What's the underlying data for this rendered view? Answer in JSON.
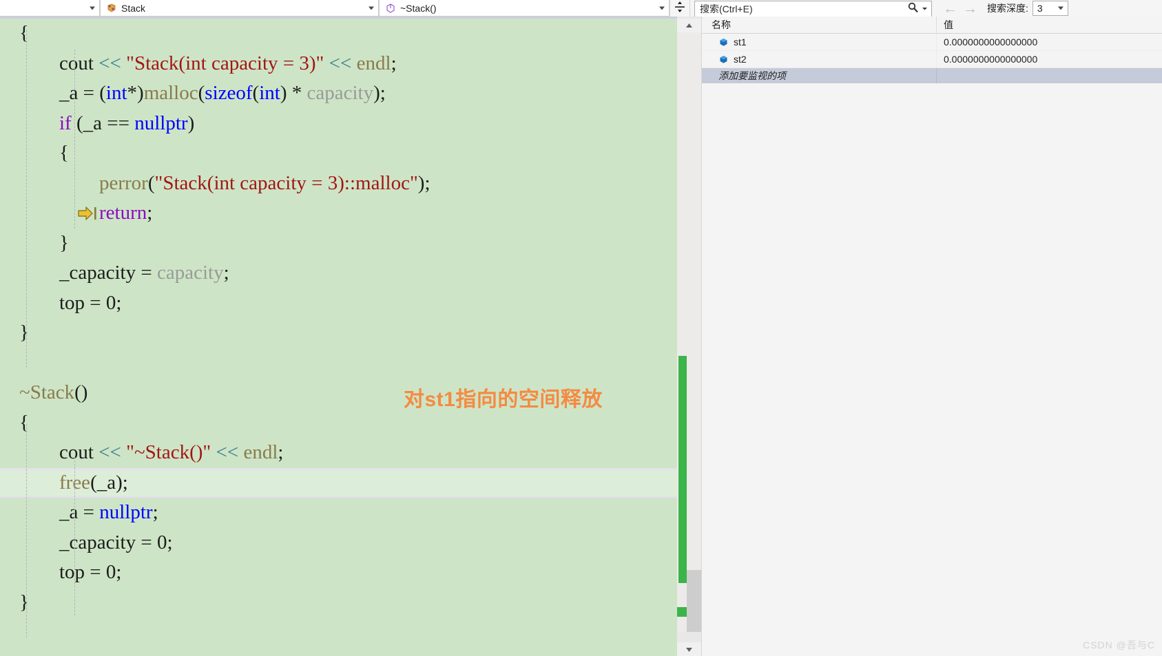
{
  "toolbar": {
    "project_combo": {
      "label": "",
      "icon": "chevron-down-icon"
    },
    "class_combo": {
      "label": "Stack",
      "icon": "class-icon"
    },
    "member_combo": {
      "label": "~Stack()",
      "icon": "method-icon"
    },
    "splitter_icon": "split-view-icon",
    "search": {
      "placeholder": "搜索(Ctrl+E)",
      "value": "",
      "icon": "search-icon"
    },
    "nav_back_icon": "arrow-left-icon",
    "nav_forward_icon": "arrow-right-icon",
    "depth_label": "搜索深度:",
    "depth_value": "3"
  },
  "editor": {
    "annotation": "对st1指向的空间释放",
    "exec_marker_icon": "current-statement-arrow-icon",
    "lines": [
      {
        "indent": 0,
        "tokens": [
          {
            "t": "{",
            "c": "t-plain"
          }
        ]
      },
      {
        "indent": 1,
        "tokens": [
          {
            "t": "cout ",
            "c": "t-plain"
          },
          {
            "t": "<<",
            "c": "t-op"
          },
          {
            "t": " ",
            "c": "t-plain"
          },
          {
            "t": "\"Stack(int capacity = 3)\"",
            "c": "t-str"
          },
          {
            "t": " ",
            "c": "t-plain"
          },
          {
            "t": "<<",
            "c": "t-op"
          },
          {
            "t": " ",
            "c": "t-plain"
          },
          {
            "t": "endl",
            "c": "t-fn"
          },
          {
            "t": ";",
            "c": "t-plain"
          }
        ]
      },
      {
        "indent": 1,
        "tokens": [
          {
            "t": "_a = (",
            "c": "t-plain"
          },
          {
            "t": "int",
            "c": "t-kw"
          },
          {
            "t": "*)",
            "c": "t-plain"
          },
          {
            "t": "malloc",
            "c": "t-fn"
          },
          {
            "t": "(",
            "c": "t-plain"
          },
          {
            "t": "sizeof",
            "c": "t-kw"
          },
          {
            "t": "(",
            "c": "t-plain"
          },
          {
            "t": "int",
            "c": "t-kw"
          },
          {
            "t": ") * ",
            "c": "t-plain"
          },
          {
            "t": "capacity",
            "c": "t-param"
          },
          {
            "t": ");",
            "c": "t-plain"
          }
        ]
      },
      {
        "indent": 1,
        "tokens": [
          {
            "t": "if",
            "c": "t-kw2"
          },
          {
            "t": " (_a == ",
            "c": "t-plain"
          },
          {
            "t": "nullptr",
            "c": "t-kw"
          },
          {
            "t": ")",
            "c": "t-plain"
          }
        ]
      },
      {
        "indent": 1,
        "tokens": [
          {
            "t": "{",
            "c": "t-plain"
          }
        ]
      },
      {
        "indent": 2,
        "tokens": [
          {
            "t": "perror",
            "c": "t-fn"
          },
          {
            "t": "(",
            "c": "t-plain"
          },
          {
            "t": "\"Stack(int capacity = 3)::malloc\"",
            "c": "t-str"
          },
          {
            "t": ");",
            "c": "t-plain"
          }
        ]
      },
      {
        "indent": 2,
        "exec": true,
        "tokens": [
          {
            "t": "return",
            "c": "t-kw2"
          },
          {
            "t": ";",
            "c": "t-plain"
          }
        ]
      },
      {
        "indent": 1,
        "tokens": [
          {
            "t": "}",
            "c": "t-plain"
          }
        ]
      },
      {
        "indent": 1,
        "tokens": [
          {
            "t": "_capacity = ",
            "c": "t-plain"
          },
          {
            "t": "capacity",
            "c": "t-param"
          },
          {
            "t": ";",
            "c": "t-plain"
          }
        ]
      },
      {
        "indent": 1,
        "tokens": [
          {
            "t": "top = 0;",
            "c": "t-plain"
          }
        ]
      },
      {
        "indent": 0,
        "tokens": [
          {
            "t": "}",
            "c": "t-plain"
          }
        ]
      },
      {
        "indent": 0,
        "tokens": [
          {
            "t": "",
            "c": "t-plain"
          }
        ]
      },
      {
        "indent": 0,
        "tokens": [
          {
            "t": "~Stack",
            "c": "t-fn"
          },
          {
            "t": "()",
            "c": "t-plain"
          }
        ]
      },
      {
        "indent": 0,
        "tokens": [
          {
            "t": "{",
            "c": "t-plain"
          }
        ]
      },
      {
        "indent": 1,
        "tokens": [
          {
            "t": "cout ",
            "c": "t-plain"
          },
          {
            "t": "<<",
            "c": "t-op"
          },
          {
            "t": " ",
            "c": "t-plain"
          },
          {
            "t": "\"~Stack()\"",
            "c": "t-str"
          },
          {
            "t": " ",
            "c": "t-plain"
          },
          {
            "t": "<<",
            "c": "t-op"
          },
          {
            "t": " ",
            "c": "t-plain"
          },
          {
            "t": "endl",
            "c": "t-fn"
          },
          {
            "t": ";",
            "c": "t-plain"
          }
        ]
      },
      {
        "indent": 1,
        "highlight": true,
        "tokens": [
          {
            "t": "free",
            "c": "t-fn"
          },
          {
            "t": "(_a);",
            "c": "t-plain"
          }
        ]
      },
      {
        "indent": 1,
        "tokens": [
          {
            "t": "_a = ",
            "c": "t-plain"
          },
          {
            "t": "nullptr",
            "c": "t-kw"
          },
          {
            "t": ";",
            "c": "t-plain"
          }
        ]
      },
      {
        "indent": 1,
        "tokens": [
          {
            "t": "_capacity = 0;",
            "c": "t-plain"
          }
        ]
      },
      {
        "indent": 1,
        "tokens": [
          {
            "t": "top = 0;",
            "c": "t-plain"
          }
        ]
      },
      {
        "indent": 0,
        "tokens": [
          {
            "t": "}",
            "c": "t-plain"
          }
        ]
      }
    ]
  },
  "watch": {
    "columns": {
      "name": "名称",
      "value": "值"
    },
    "rows": [
      {
        "icon": "variable-icon",
        "name": "st1",
        "value": "0.0000000000000000"
      },
      {
        "icon": "variable-icon",
        "name": "st2",
        "value": "0.0000000000000000"
      }
    ],
    "add_placeholder": "添加要监视的项"
  },
  "watermark": "CSDN @吾与C",
  "colors": {
    "editor_background": "#cde5c6",
    "highlight_line": "#ddeed8",
    "annotation": "#f58a42",
    "scrollbar_marker": "#3bb44a",
    "string_token": "#a31515",
    "keyword_token": "#0000ff",
    "control_keyword_token": "#8f08c4",
    "function_token": "#8a7a4e",
    "operator_token": "#3a7a8c"
  }
}
